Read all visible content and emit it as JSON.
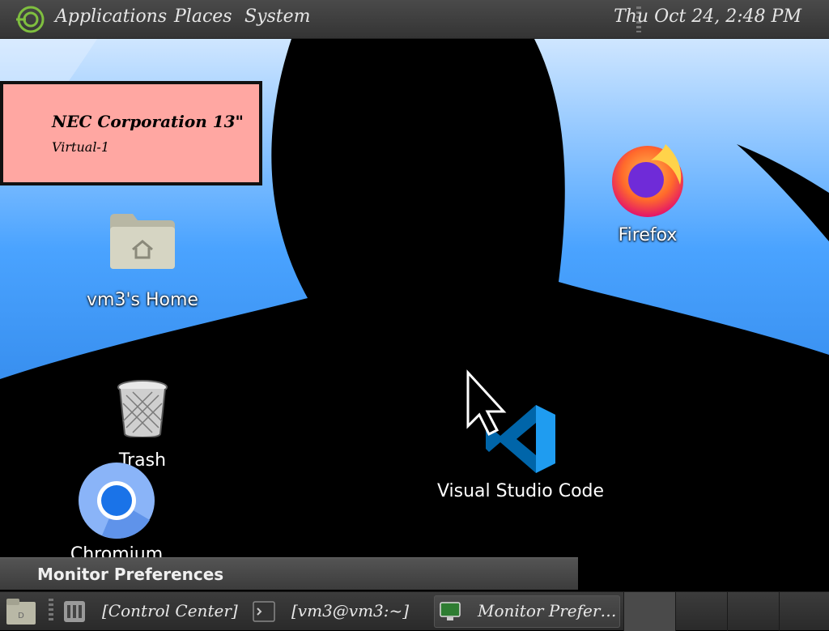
{
  "top_panel": {
    "menu": [
      "Applications",
      "Places",
      "System"
    ],
    "clock": "Thu Oct 24,  2:48 PM"
  },
  "monitor_label": {
    "title": "NEC Corporation 13\"",
    "subtitle": "Virtual-1"
  },
  "desktop_icons": {
    "home": "vm3's Home",
    "trash": "Trash",
    "chromium": "Chromium",
    "firefox": "Firefox",
    "vscode": "Visual Studio Code"
  },
  "window": {
    "title": "Monitor Preferences"
  },
  "taskbar": {
    "items": [
      "[Control Center]",
      "[vm3@vm3:~]",
      "Monitor Prefer…"
    ]
  },
  "colors": {
    "monitor_label_bg": "#ffa7a2",
    "panel_bg": "#3a3a3a"
  }
}
